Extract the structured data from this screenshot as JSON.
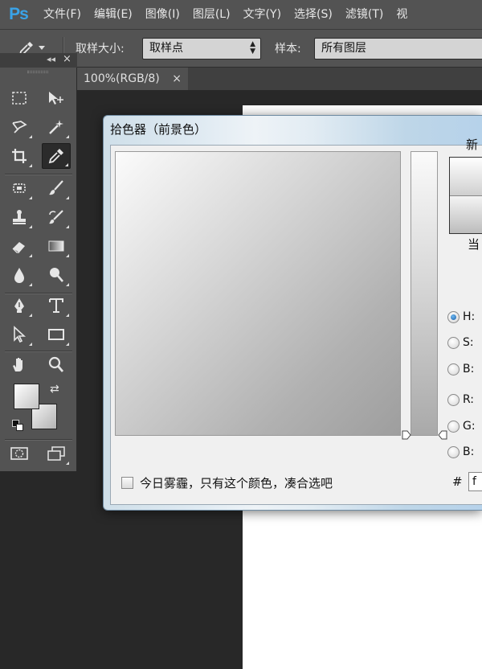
{
  "app": {
    "logo": "Ps"
  },
  "menu": [
    "文件(F)",
    "编辑(E)",
    "图像(I)",
    "图层(L)",
    "文字(Y)",
    "选择(S)",
    "滤镜(T)",
    "视"
  ],
  "options_bar": {
    "sample_size_label": "取样大小:",
    "sample_size_value": "取样点",
    "sample_label": "样本:",
    "sample_value": "所有图层"
  },
  "doc_tab": {
    "title": "100%(RGB/8)",
    "close": "×"
  },
  "toolbox": {
    "collapse": "◂◂",
    "close": "×",
    "tools": [
      "rectangular-marquee",
      "move",
      "lasso",
      "magic-wand",
      "crop",
      "eyedropper",
      "spot-healing",
      "brush",
      "clone-stamp",
      "history-brush",
      "eraser",
      "gradient",
      "blur",
      "dodge",
      "pen",
      "type",
      "path-selection",
      "rectangle",
      "hand",
      "zoom"
    ],
    "active_tool": "eyedropper",
    "foreground_color": "#ffffff",
    "background_color": "#f2f2f2"
  },
  "color_picker": {
    "title": "拾色器（前景色）",
    "new_label": "新",
    "current_label": "当",
    "fields": [
      {
        "label": "H:",
        "selected": true
      },
      {
        "label": "S:",
        "selected": false
      },
      {
        "label": "B:",
        "selected": false
      },
      {
        "label": "R:",
        "selected": false
      },
      {
        "label": "G:",
        "selected": false
      },
      {
        "label": "B:",
        "selected": false
      }
    ],
    "hex_prefix": "#",
    "hex_value": "f",
    "only_web_label": "今日雾霾，只有这个颜色，凑合选吧"
  }
}
